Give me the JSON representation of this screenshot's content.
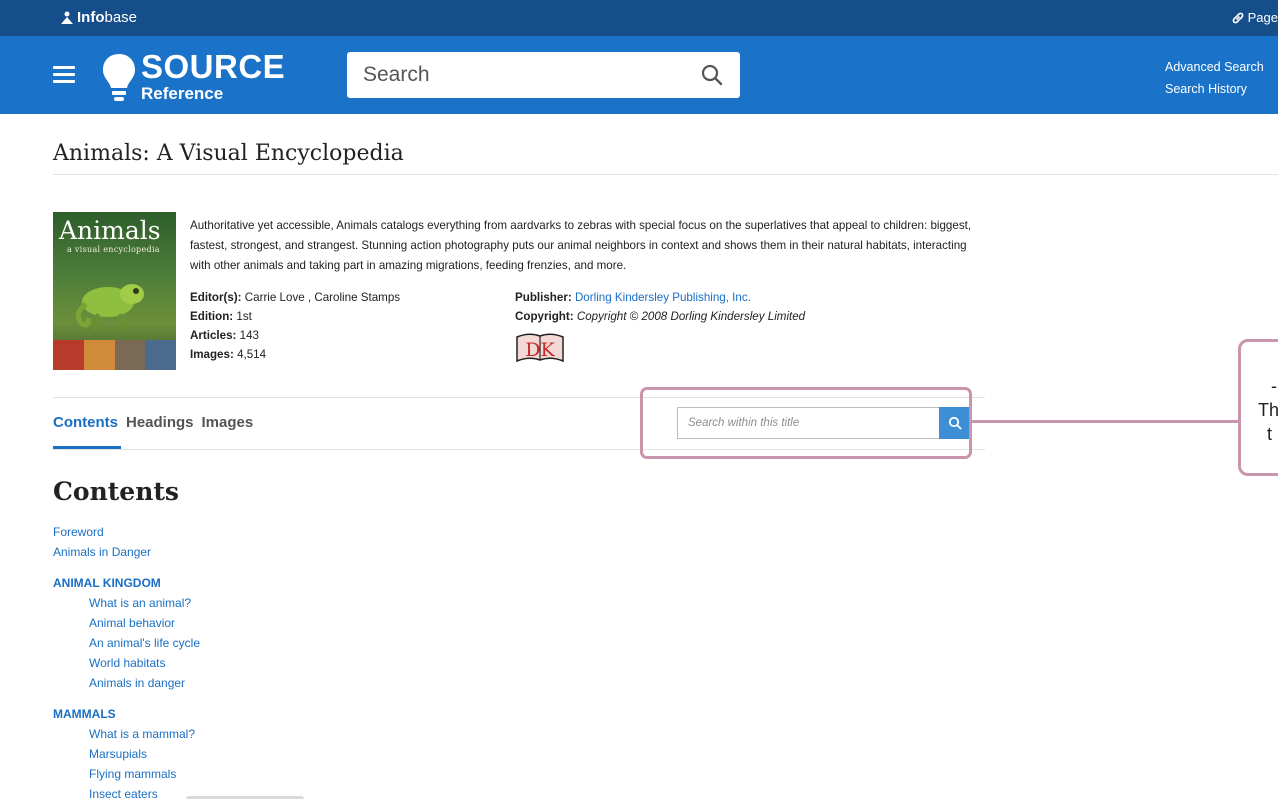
{
  "topbar": {
    "brand_prefix": "Info",
    "brand_suffix": "base",
    "page_link": "Page"
  },
  "header": {
    "logo_title": "SOURCE",
    "logo_subtitle": "Reference",
    "search_placeholder": "Search",
    "advanced_search": "Advanced Search",
    "search_history": "Search History"
  },
  "book": {
    "title": "Animals: A Visual Encyclopedia",
    "cover_title": "Animals",
    "cover_subtitle": "a visual encyclopedia",
    "description": "Authoritative yet accessible, Animals catalogs everything from aardvarks to zebras with special focus on the superlatives that appeal to children: biggest, fastest, strongest, and strangest. Stunning action photography puts our animal neighbors in context and shows them in their natural habitats, interacting with other animals and taking part in amazing migrations, feeding frenzies, and more.",
    "editors_label": "Editor(s):",
    "editors_value": "Carrie Love , Caroline Stamps",
    "edition_label": "Edition:",
    "edition_value": "1st",
    "articles_label": "Articles:",
    "articles_value": "143",
    "images_label": "Images:",
    "images_value": "4,514",
    "publisher_label": "Publisher:",
    "publisher_value": "Dorling Kindersley Publishing, Inc.",
    "copyright_label": "Copyright:",
    "copyright_value": "Copyright © 2008 Dorling Kindersley Limited",
    "publisher_logo": "DK"
  },
  "tabs": [
    {
      "label": "Contents",
      "active": true
    },
    {
      "label": "Headings",
      "active": false
    },
    {
      "label": "Images",
      "active": false
    }
  ],
  "within_search": {
    "placeholder": "Search within this title"
  },
  "callout": {
    "line1": "-",
    "line2": "Th",
    "line3": "t"
  },
  "contents": {
    "heading": "Contents",
    "front": [
      "Foreword",
      "Animals in Danger"
    ],
    "sections": [
      {
        "title": "ANIMAL KINGDOM",
        "items": [
          "What is an animal?",
          "Animal behavior",
          "An animal's life cycle",
          "World habitats",
          "Animals in danger"
        ]
      },
      {
        "title": "MAMMALS",
        "items": [
          "What is a mammal?",
          "Marsupials",
          "Flying mammals",
          "Insect eaters"
        ]
      }
    ]
  },
  "colors": {
    "topbar": "#164d8b",
    "header": "#1a73c9",
    "link": "#1a6fc4",
    "callout": "#c995ad"
  }
}
